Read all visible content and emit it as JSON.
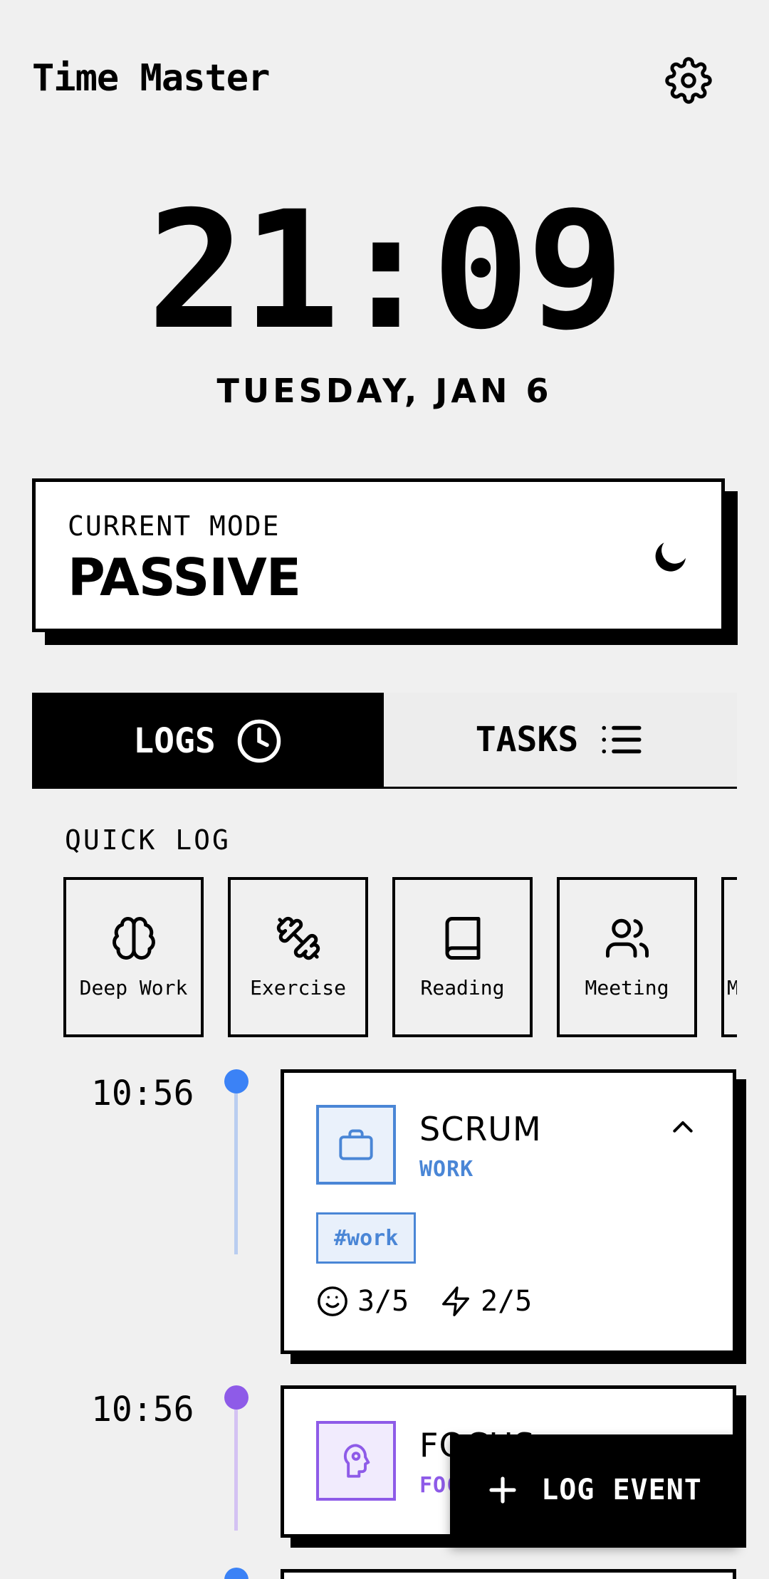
{
  "header": {
    "title": "Time Master",
    "settings_icon": "gear-icon"
  },
  "clock": {
    "time": "21:09",
    "date": "TUESDAY, JAN 6"
  },
  "mode": {
    "label": "CURRENT MODE",
    "value": "PASSIVE",
    "icon": "moon-icon"
  },
  "tabs": [
    {
      "label": "LOGS",
      "icon": "clock-icon",
      "active": true
    },
    {
      "label": "TASKS",
      "icon": "list-icon",
      "active": false
    }
  ],
  "quick_log": {
    "title": "QUICK LOG",
    "items": [
      {
        "label": "Deep Work",
        "icon": "brain-icon"
      },
      {
        "label": "Exercise",
        "icon": "dumbbell-icon"
      },
      {
        "label": "Reading",
        "icon": "book-icon"
      },
      {
        "label": "Meeting",
        "icon": "users-icon"
      },
      {
        "label": "M",
        "icon": "unknown"
      }
    ]
  },
  "entries": [
    {
      "time": "10:56",
      "title": "SCRUM",
      "category": "WORK",
      "color": "#4a86d6",
      "icon": "briefcase-icon",
      "tag": "#work",
      "mood": "3/5",
      "energy": "2/5",
      "expanded": true
    },
    {
      "time": "10:56",
      "title": "FOCUS",
      "category": "FOCUS",
      "color": "#8e5be8",
      "icon": "head-gear-icon",
      "expanded": false
    }
  ],
  "fab": {
    "label": "LOG EVENT",
    "icon": "plus-icon"
  },
  "colors": {
    "background": "#f0f0f0",
    "work": "#4a86d6",
    "focus": "#8e5be8",
    "third": "#3b82f6"
  }
}
